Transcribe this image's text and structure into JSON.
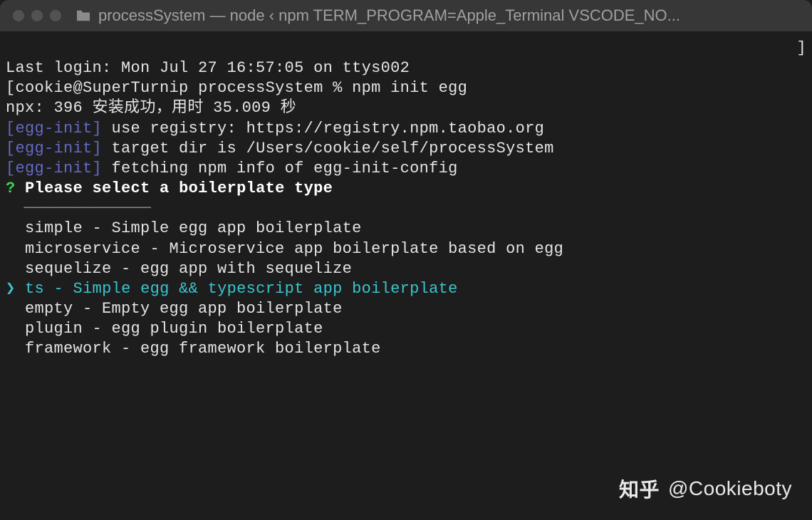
{
  "titlebar": {
    "folder_name": "processSystem",
    "separator": "—",
    "process": "node",
    "arrow": "‹",
    "rest": "npm TERM_PROGRAM=Apple_Terminal VSCODE_NO..."
  },
  "terminal": {
    "last_login": "Last login: Mon Jul 27 16:57:05 on ttys002",
    "prompt": {
      "user_host": "cookie@SuperTurnip",
      "cwd": "processSystem",
      "symbol": "%",
      "command": "npm init egg"
    },
    "npx_line": "npx: 396 安装成功，用时 35.009 秒",
    "egg_init_tag": "[egg-init]",
    "egg_lines": [
      " use registry: https://registry.npm.taobao.org",
      " target dir is /Users/cookie/self/processSystem",
      " fetching npm info of egg-init-config"
    ],
    "question_mark": "?",
    "prompt_question": "Please select a boilerplate type",
    "separator_line": "  ──────────────",
    "options": [
      {
        "name": "simple",
        "desc": "Simple egg app boilerplate",
        "selected": false
      },
      {
        "name": "microservice",
        "desc": "Microservice app boilerplate based on egg",
        "selected": false
      },
      {
        "name": "sequelize",
        "desc": "egg app with sequelize",
        "selected": false
      },
      {
        "name": "ts",
        "desc": "Simple egg && typescript app boilerplate",
        "selected": true
      },
      {
        "name": "empty",
        "desc": "Empty egg app boilerplate",
        "selected": false
      },
      {
        "name": "plugin",
        "desc": "egg plugin boilerplate",
        "selected": false
      },
      {
        "name": "framework",
        "desc": "egg framework boilerplate",
        "selected": false
      }
    ],
    "selector_arrow": "❯"
  },
  "watermark": {
    "zhihu": "知乎",
    "handle": "@Cookieboty"
  }
}
